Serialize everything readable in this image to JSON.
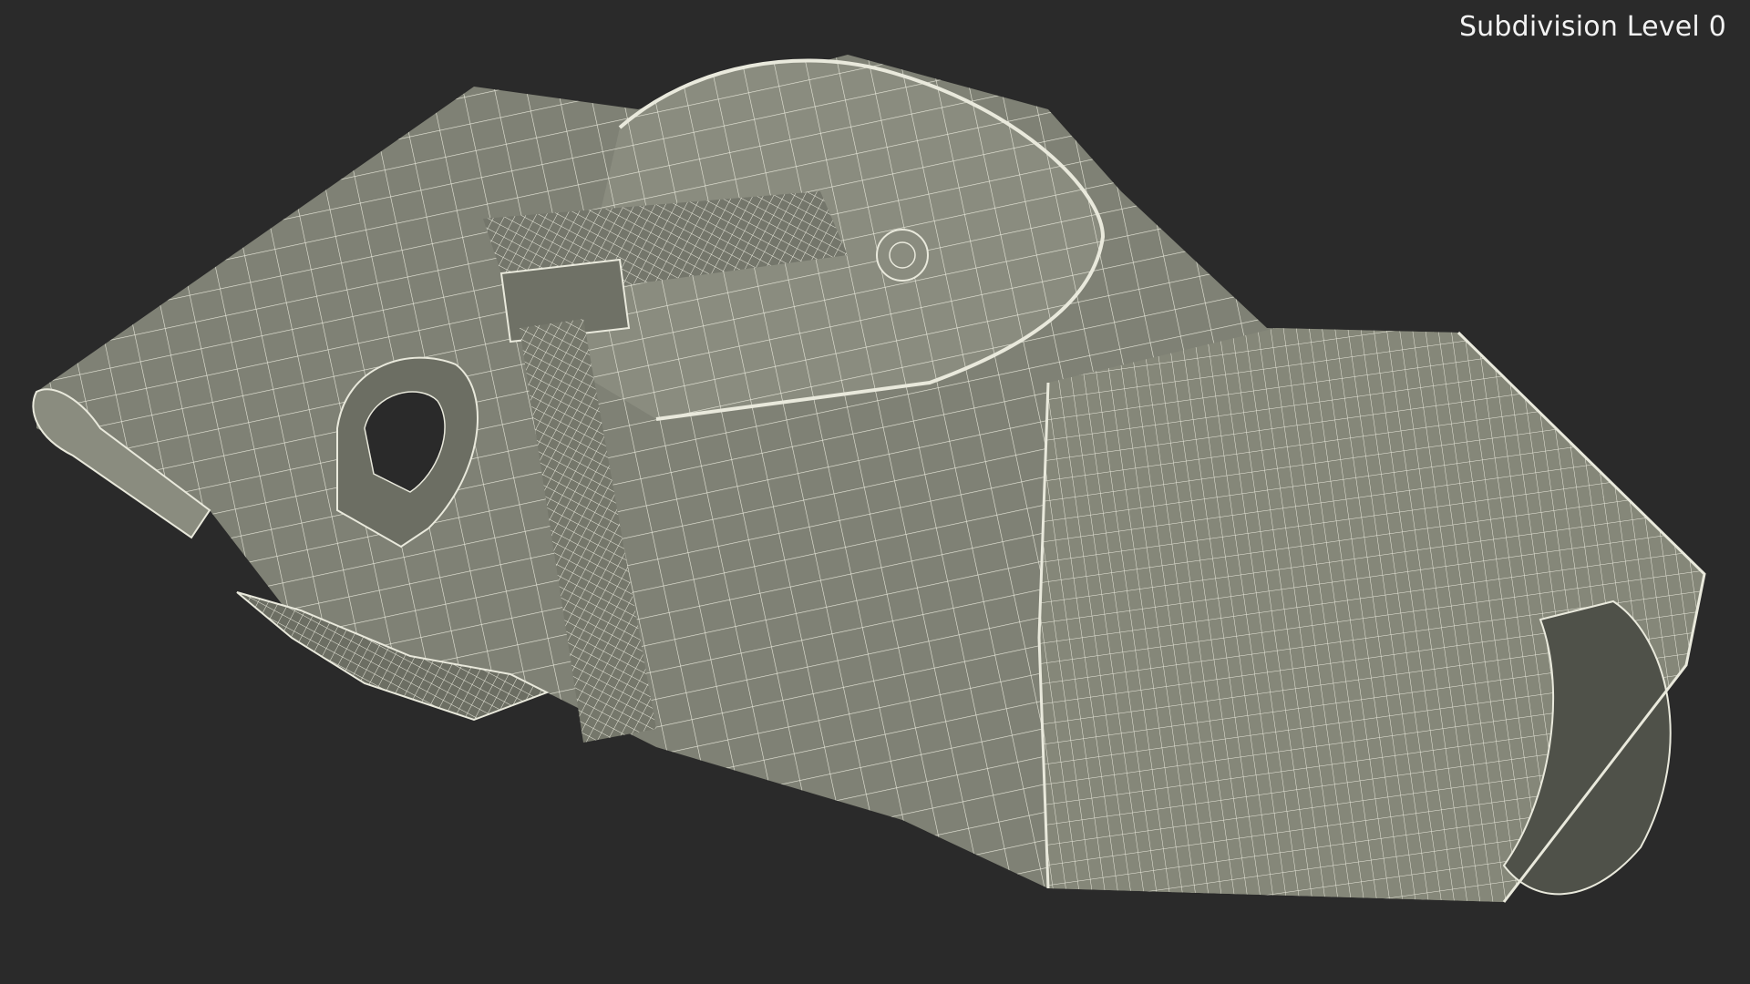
{
  "viewport": {
    "background": "#2a2a2a",
    "label": "Subdivision Level 0"
  },
  "model": {
    "surface_color": "#7f8175",
    "shadow_color": "#5d5f55",
    "highlight_color": "#979a8c",
    "wire_color": "#e9e9dc"
  }
}
